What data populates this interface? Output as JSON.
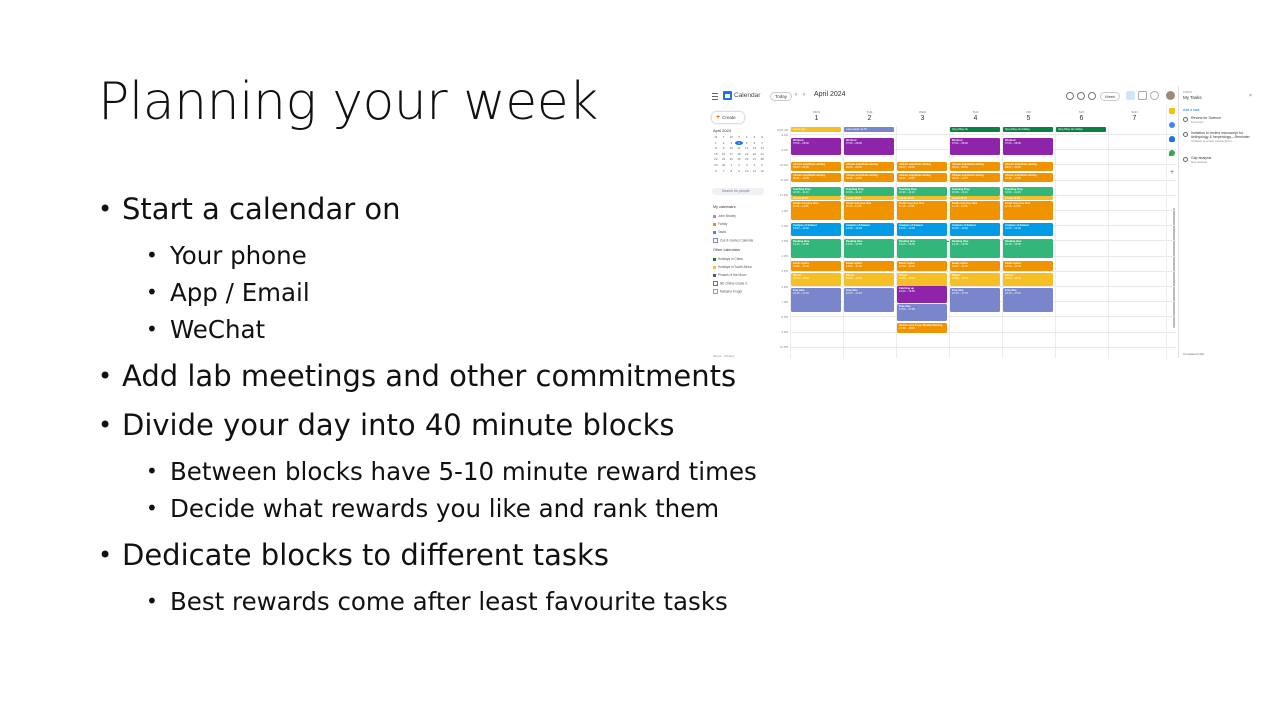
{
  "slide": {
    "title": "Planning your week",
    "bullets": {
      "b1": "Start a calendar on",
      "b1a": "Your phone",
      "b1b": "App / Email",
      "b1c": "WeChat",
      "b2": "Add lab meetings and other commitments",
      "b3": "Divide your day into 40 minute blocks",
      "b3a": "Between blocks have 5-10 minute reward times",
      "b3b": "Decide what rewards you like and rank them",
      "b4": "Dedicate blocks to different tasks",
      "b4a": "Best rewards come after least favourite tasks"
    }
  },
  "calendar": {
    "app_name": "Calendar",
    "today_label": "Today",
    "month_title": "April 2024",
    "view_label": "Week",
    "create_label": "Create",
    "mini_month": "April 2024",
    "mini_days": [
      "M",
      "T",
      "W",
      "T",
      "F",
      "S",
      "S",
      "1",
      "2",
      "3",
      "4",
      "5",
      "6",
      "7",
      "8",
      "9",
      "10",
      "11",
      "12",
      "13",
      "14",
      "15",
      "16",
      "17",
      "18",
      "19",
      "20",
      "21",
      "22",
      "23",
      "24",
      "25",
      "26",
      "27",
      "28",
      "29",
      "30",
      "1",
      "2",
      "3",
      "4",
      "5",
      "6",
      "7",
      "8",
      "9",
      "10",
      "11",
      "12"
    ],
    "search_people": "Search for people",
    "my_calendars_label": "My calendars",
    "my_calendars": [
      "John Mosley",
      "Family",
      "Tasks",
      "Zoë & Gomez Calendar"
    ],
    "other_calendars_label": "Other calendars",
    "other_calendars": [
      "Holidays in China",
      "Holidays in South Africa",
      "Phases of the Moon",
      "NE Online Grade 3",
      "Natasha Kruger"
    ],
    "footer": "Terms – Privacy",
    "days": [
      {
        "name": "MON",
        "num": "1"
      },
      {
        "name": "TUE",
        "num": "2"
      },
      {
        "name": "WED",
        "num": "3"
      },
      {
        "name": "THU",
        "num": "4"
      },
      {
        "name": "FRI",
        "num": "5"
      },
      {
        "name": "SAT",
        "num": "6"
      },
      {
        "name": "SUN",
        "num": "7"
      }
    ],
    "gmt_label": "GMT+08",
    "times": [
      "8 AM",
      "9 AM",
      "10 AM",
      "11 AM",
      "12 PM",
      "1 PM",
      "2 PM",
      "3 PM",
      "4 PM",
      "5 PM",
      "6 PM",
      "7 PM",
      "8 PM",
      "9 PM",
      "10 PM"
    ],
    "allday_events": {
      "mon": "Family day",
      "tue": "Last quarter 11:15",
      "thu": "Qing Ming Jie",
      "fri": "Qing Ming Jie holiday",
      "sat": "Qing Ming Jie holiday"
    },
    "events": {
      "workout": "Workout",
      "workout_time": "07:00 – 08:00",
      "writing": "African amphibian writing",
      "writing_time": "09:00 – 09:40",
      "writing2_time": "09:45 – 10:25",
      "teaching": "Teaching Prep",
      "teaching_time": "10:30 – 11:10",
      "lunch": "Lunch 11:10",
      "email": "Email response time",
      "email_time": "11:15 – 11:55",
      "analysis": "Analysis of dataset",
      "analysis_time": "12:00 – 12:40",
      "reading": "Reading time",
      "reading_time": "13:15 – 13:55",
      "email_replies": "Email replies",
      "email_replies_time": "14:00 – 14:40",
      "dinner": "Dinner",
      "dinner_time": "15:00 – 15:40",
      "free_time": "Free time",
      "free_time_time": "16:15 – 17:15",
      "catch_up": "Catching up",
      "catch_up_time": "16:00 – 16:50",
      "wed_free_time": "17:00 – 17:30",
      "lab_meeting": "Herbivorous Frogs Weekly Meeting",
      "lab_meeting_time": "17:30 – 18:00"
    }
  },
  "tasks": {
    "label": "TASKS",
    "list_name": "My Tasks",
    "add_task": "Add a task",
    "items": [
      {
        "title": "Review for Science",
        "sub": "Tomorrow"
      },
      {
        "title": "Invitation to review manuscript for ichthyology & herpetology—Reminder",
        "sub": "Invitation to review manuscript fo..."
      },
      {
        "title": "Gap analysis",
        "sub": "Gap analysis"
      }
    ],
    "completed": "Completed (10)"
  },
  "colors": {
    "purple": "#8e24aa",
    "orange": "#f09300",
    "green": "#33b679",
    "blue": "#039be5",
    "teal": "#0b8043",
    "lavender": "#7986cb",
    "yellow": "#f6bf26",
    "darkgreen": "#0b8043"
  }
}
